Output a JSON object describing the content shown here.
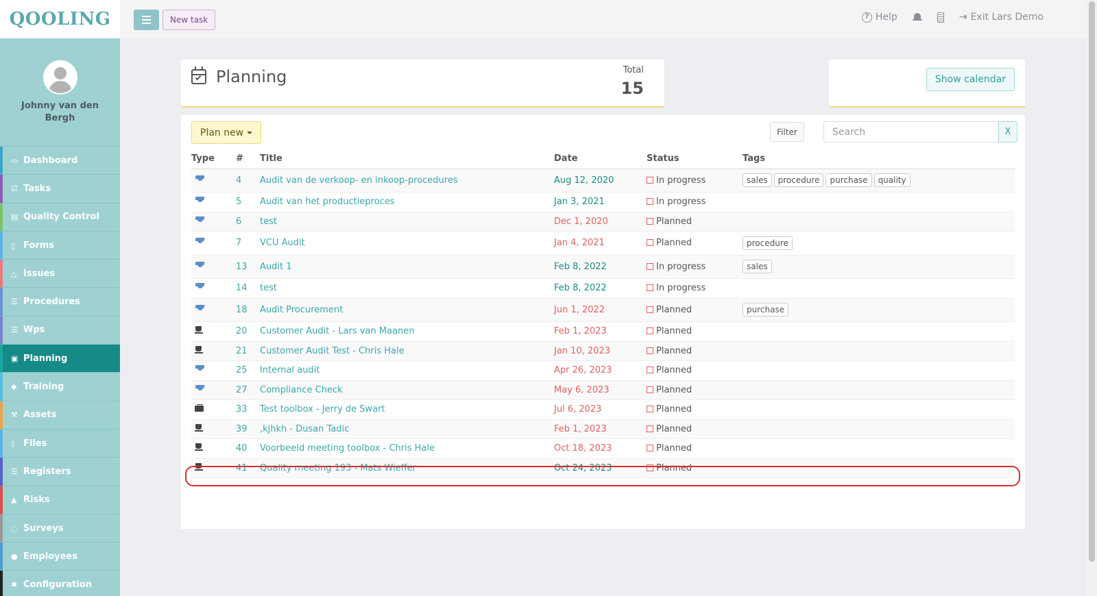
{
  "app": {
    "logo": "QOOLING"
  },
  "topbar": {
    "new_task_label": "New task",
    "help_label": "Help",
    "exit_label": "Exit Lars Demo"
  },
  "user": {
    "name": "Johnny van den Bergh"
  },
  "sidebar": {
    "items": [
      {
        "label": "Dashboard",
        "icon": "monitor-icon",
        "accent": "#3aa6c9"
      },
      {
        "label": "Tasks",
        "icon": "checkbox-icon",
        "accent": "#8b5fb8"
      },
      {
        "label": "Quality Control",
        "icon": "book-icon",
        "accent": "#7bc46a"
      },
      {
        "label": "Forms",
        "icon": "document-icon",
        "accent": "#5ab3e8"
      },
      {
        "label": "Issues",
        "icon": "bell-icon",
        "accent": "#e77b7b"
      },
      {
        "label": "Procedures",
        "icon": "list-icon",
        "accent": "#6c8fd6"
      },
      {
        "label": "Wps",
        "icon": "list-icon",
        "accent": "#7d7fcf"
      },
      {
        "label": "Planning",
        "icon": "calendar-check-icon",
        "accent": "#1aa8a0",
        "active": true
      },
      {
        "label": "Training",
        "icon": "graduation-cap-icon",
        "accent": "#4fc1e0"
      },
      {
        "label": "Assets",
        "icon": "wrench-icon",
        "accent": "#f0a24a"
      },
      {
        "label": "Files",
        "icon": "file-icon",
        "accent": "#5ab3e8"
      },
      {
        "label": "Registers",
        "icon": "list-icon",
        "accent": "#5b5fc7"
      },
      {
        "label": "Risks",
        "icon": "warning-icon",
        "accent": "#e04b4b"
      },
      {
        "label": "Surveys",
        "icon": "comment-icon",
        "accent": "#999999"
      },
      {
        "label": "Employees",
        "icon": "users-icon",
        "accent": "#4aa0d6"
      },
      {
        "label": "Configuration",
        "icon": "gear-icon",
        "accent": "#222222"
      }
    ]
  },
  "header": {
    "title": "Planning",
    "total_label": "Total",
    "total_value": "15",
    "show_calendar_label": "Show calendar"
  },
  "toolbar": {
    "plan_new_label": "Plan new",
    "filter_label": "Filter",
    "search_placeholder": "Search",
    "clear_label": "X"
  },
  "table": {
    "columns": [
      "Type",
      "#",
      "Title",
      "Date",
      "Status",
      "Tags"
    ],
    "rows": [
      {
        "type": "cap",
        "num": "4",
        "title": "Audit van de verkoop- en inkoop-procedures",
        "date": "Aug 12, 2020",
        "date_state": "future",
        "status": "In progress",
        "tags": [
          "sales",
          "procedure",
          "purchase",
          "quality"
        ]
      },
      {
        "type": "cap",
        "num": "5",
        "title": "Audit van het productieproces",
        "date": "Jan 3, 2021",
        "date_state": "future",
        "status": "In progress",
        "tags": []
      },
      {
        "type": "cap",
        "num": "6",
        "title": "test",
        "date": "Dec 1, 2020",
        "date_state": "past",
        "status": "Planned",
        "tags": []
      },
      {
        "type": "cap",
        "num": "7",
        "title": "VCU Audit",
        "date": "Jan 4, 2021",
        "date_state": "past",
        "status": "Planned",
        "tags": [
          "procedure"
        ]
      },
      {
        "type": "cap",
        "num": "13",
        "title": "Audit 1",
        "date": "Feb 8, 2022",
        "date_state": "future",
        "status": "In progress",
        "tags": [
          "sales"
        ]
      },
      {
        "type": "cap",
        "num": "14",
        "title": "test",
        "date": "Feb 8, 2022",
        "date_state": "future",
        "status": "In progress",
        "tags": []
      },
      {
        "type": "cap",
        "num": "18",
        "title": "Audit Procurement",
        "date": "Jun 1, 2022",
        "date_state": "past",
        "status": "Planned",
        "tags": [
          "purchase"
        ]
      },
      {
        "type": "cup",
        "num": "20",
        "title": "Customer Audit - Lars van Maanen",
        "date": "Feb 1, 2023",
        "date_state": "past",
        "status": "Planned",
        "tags": []
      },
      {
        "type": "cup",
        "num": "21",
        "title": "Customer Audit Test - Chris Hale",
        "date": "Jan 10, 2023",
        "date_state": "past",
        "status": "Planned",
        "tags": []
      },
      {
        "type": "cap",
        "num": "25",
        "title": "Internal audit",
        "date": "Apr 26, 2023",
        "date_state": "past",
        "status": "Planned",
        "tags": []
      },
      {
        "type": "cap",
        "num": "27",
        "title": "Compliance Check",
        "date": "May 6, 2023",
        "date_state": "past",
        "status": "Planned",
        "tags": []
      },
      {
        "type": "brief",
        "num": "33",
        "title": "Test toolbox - Jerry de Swart",
        "date": "Jul 6, 2023",
        "date_state": "past",
        "status": "Planned",
        "tags": []
      },
      {
        "type": "cup",
        "num": "39",
        "title": ",kjhkh - Dusan Tadic",
        "date": "Feb 1, 2023",
        "date_state": "past",
        "status": "Planned",
        "tags": []
      },
      {
        "type": "cup",
        "num": "40",
        "title": "Voorbeeld meeting toolbox - Chris Hale",
        "date": "Oct 18, 2023",
        "date_state": "past",
        "status": "Planned",
        "tags": []
      },
      {
        "type": "cup",
        "num": "41",
        "title": "Quality meeting 193 - Mats Wieffer",
        "date": "Oct 24, 2023",
        "date_state": "future",
        "status": "Planned",
        "tags": []
      }
    ]
  },
  "colors": {
    "brand": "#5aa9ad",
    "sidebar_bg": "#9fd1d3",
    "active_nav": "#168a86",
    "link": "#3ba7ad",
    "overdue": "#e0615f",
    "highlight": "#d92d2d"
  }
}
